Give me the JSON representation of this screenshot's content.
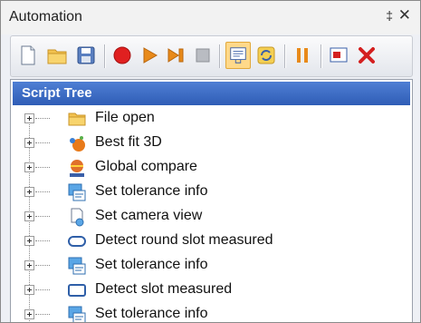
{
  "panel": {
    "title": "Automation",
    "pin_glyph": "‡",
    "close_glyph": "✕"
  },
  "toolbar": {
    "buttons": [
      {
        "name": "new-script",
        "icon": "new-document-icon"
      },
      {
        "name": "open-script",
        "icon": "folder-icon"
      },
      {
        "name": "save-script",
        "icon": "floppy-disk-icon"
      },
      {
        "name": "record",
        "icon": "record-icon"
      },
      {
        "name": "play",
        "icon": "play-icon"
      },
      {
        "name": "step",
        "icon": "step-forward-icon"
      },
      {
        "name": "stop",
        "icon": "stop-icon"
      },
      {
        "name": "script-editor",
        "icon": "script-editor-icon",
        "active": true
      },
      {
        "name": "refresh",
        "icon": "refresh-icon"
      },
      {
        "name": "pause",
        "icon": "pause-icon"
      },
      {
        "name": "capture",
        "icon": "screenshot-icon"
      },
      {
        "name": "delete",
        "icon": "delete-icon"
      }
    ],
    "colors": {
      "record": "#e02020",
      "play": "#e88a1a",
      "active_bg": "#ffd98a",
      "delete": "#d42020"
    }
  },
  "tree": {
    "header": "Script Tree",
    "header_color": "#3a67c4",
    "items": [
      {
        "label": "File open",
        "icon": "folder-icon"
      },
      {
        "label": "Best fit 3D",
        "icon": "best-fit-icon"
      },
      {
        "label": "Global compare",
        "icon": "global-compare-icon"
      },
      {
        "label": "Set tolerance info",
        "icon": "tolerance-icon"
      },
      {
        "label": "Set camera view",
        "icon": "camera-view-icon"
      },
      {
        "label": "Detect round slot measured",
        "icon": "round-slot-icon"
      },
      {
        "label": "Set tolerance info",
        "icon": "tolerance-icon"
      },
      {
        "label": "Detect slot measured",
        "icon": "slot-icon"
      },
      {
        "label": "Set tolerance info",
        "icon": "tolerance-icon"
      }
    ]
  }
}
